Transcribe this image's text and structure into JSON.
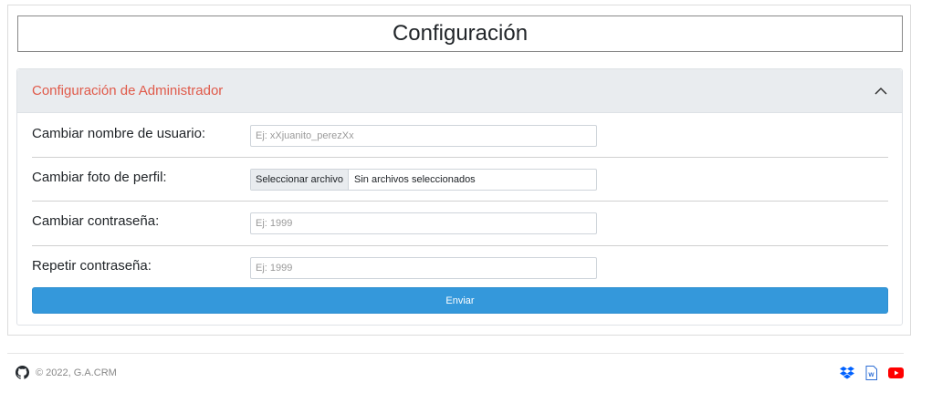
{
  "page": {
    "title": "Configuración"
  },
  "panel": {
    "title": "Configuración de Administrador",
    "collapse_icon": "chevron-up-icon",
    "accent_color": "#e05a4a"
  },
  "form": {
    "username": {
      "label": "Cambiar nombre de usuario:",
      "placeholder": "Ej: xXjuanito_perezXx",
      "value": ""
    },
    "photo": {
      "label": "Cambiar foto de perfil:",
      "button_label": "Seleccionar archivo",
      "status_text": "Sin archivos seleccionados"
    },
    "password": {
      "label": "Cambiar contraseña:",
      "placeholder": "Ej: 1999",
      "value": ""
    },
    "repeat_password": {
      "label": "Repetir contraseña:",
      "placeholder": "Ej: 1999",
      "value": ""
    },
    "submit_label": "Enviar",
    "submit_color": "#3498db"
  },
  "footer": {
    "copyright": "© 2022, G.A.CRM",
    "left_icon": "github-icon",
    "right_icons": [
      "dropbox-icon",
      "word-document-icon",
      "youtube-icon"
    ]
  }
}
